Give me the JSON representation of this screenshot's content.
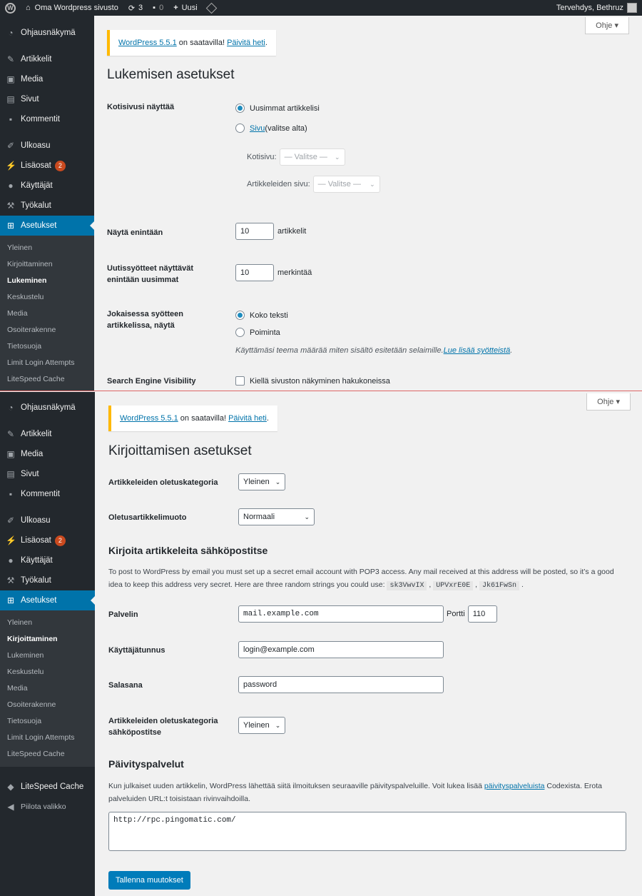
{
  "adminbar": {
    "site_name": "Oma Wordpress sivusto",
    "updates": "3",
    "comments": "0",
    "new_label": "Uusi",
    "greeting": "Tervehdys, Bethruz"
  },
  "panel1": {
    "menu": [
      {
        "label": "Ohjausnäkymä",
        "icon": "dashboard-icon"
      },
      {
        "label": "Artikkelit",
        "icon": "pin-icon"
      },
      {
        "label": "Media",
        "icon": "media-icon"
      },
      {
        "label": "Sivut",
        "icon": "page-icon"
      },
      {
        "label": "Kommentit",
        "icon": "comment-icon"
      },
      {
        "label": "Ulkoasu",
        "icon": "brush-icon"
      },
      {
        "label": "Lisäosat",
        "icon": "plugin-icon",
        "badge": "2"
      },
      {
        "label": "Käyttäjät",
        "icon": "user-icon"
      },
      {
        "label": "Työkalut",
        "icon": "wrench-icon"
      },
      {
        "label": "Asetukset",
        "icon": "settings-icon"
      }
    ],
    "submenu": [
      "Yleinen",
      "Kirjoittaminen",
      "Lukeminen",
      "Keskustelu",
      "Media",
      "Osoiterakenne",
      "Tietosuoja",
      "Limit Login Attempts",
      "LiteSpeed Cache"
    ],
    "help": "Ohje ▾",
    "notice": {
      "link1": "WordPress 5.5.1",
      "middle": " on saatavilla! ",
      "link2": "Päivitä heti",
      "end": "."
    },
    "title": "Lukemisen asetukset",
    "homepage_label": "Kotisivusi näyttää",
    "opt_latest": "Uusimmat artikkelisi",
    "opt_page_link": "Sivu",
    "opt_page_rest": " (valitse alta)",
    "homepage_sub": "Kotisivu:",
    "posts_page_sub": "Artikkeleiden sivu:",
    "select_placeholder": "— Valitse —",
    "show_max_label": "Näytä enintään",
    "show_max_value": "10",
    "show_max_unit": "artikkelit",
    "feed_label_1": "Uutissyötteet näyttävät",
    "feed_label_2": "enintään uusimmat",
    "feed_value": "10",
    "feed_unit": "merkintää",
    "each_label_1": "Jokaisessa syötteen",
    "each_label_2": "artikkelissa, näytä",
    "opt_full": "Koko teksti",
    "opt_summary": "Poiminta",
    "theme_desc": "Käyttämäsi teema määrää miten sisältö esitetään selaimille. ",
    "theme_link": "Lue lisää syötteistä",
    "theme_end": ".",
    "sev_label": "Search Engine Visibility",
    "sev_check": "Kiellä sivuston näkyminen hakukoneissa"
  },
  "panel2": {
    "menu": [
      {
        "label": "Ohjausnäkymä",
        "icon": "dashboard-icon"
      },
      {
        "label": "Artikkelit",
        "icon": "pin-icon"
      },
      {
        "label": "Media",
        "icon": "media-icon"
      },
      {
        "label": "Sivut",
        "icon": "page-icon"
      },
      {
        "label": "Kommentit",
        "icon": "comment-icon"
      },
      {
        "label": "Ulkoasu",
        "icon": "brush-icon"
      },
      {
        "label": "Lisäosat",
        "icon": "plugin-icon",
        "badge": "2"
      },
      {
        "label": "Käyttäjät",
        "icon": "user-icon"
      },
      {
        "label": "Työkalut",
        "icon": "wrench-icon"
      },
      {
        "label": "Asetukset",
        "icon": "settings-icon"
      }
    ],
    "submenu": [
      "Yleinen",
      "Kirjoittaminen",
      "Lukeminen",
      "Keskustelu",
      "Media",
      "Osoiterakenne",
      "Tietosuoja",
      "Limit Login Attempts",
      "LiteSpeed Cache"
    ],
    "extra_menu": [
      {
        "label": "LiteSpeed Cache",
        "icon": "litespeed-icon"
      },
      {
        "label": "Piilota valikko",
        "icon": "collapse-icon"
      }
    ],
    "help": "Ohje ▾",
    "notice": {
      "link1": "WordPress 5.5.1",
      "middle": " on saatavilla! ",
      "link2": "Päivitä heti",
      "end": "."
    },
    "title": "Kirjoittamisen asetukset",
    "default_cat_label": "Artikkeleiden oletuskategoria",
    "default_cat_value": "Yleinen",
    "default_format_label": "Oletusartikkelimuoto",
    "default_format_value": "Normaali",
    "post_via_email_heading": "Kirjoita artikkeleita sähköpostitse",
    "email_desc_1": "To post to WordPress by email you must set up a secret email account with POP3 access. Any mail received at this address will be posted, so it’s a good",
    "email_desc_2": "idea to keep this address very secret. Here are three random strings you could use:",
    "codes": [
      "sk3VwvIX",
      "UPVxrE0E",
      "Jk61FwSn"
    ],
    "server_label": "Palvelin",
    "server_value": "mail.example.com",
    "port_label": "Portti",
    "port_value": "110",
    "username_label": "Käyttäjätunnus",
    "username_value": "login@example.com",
    "password_label": "Salasana",
    "password_value": "password",
    "email_cat_label_1": "Artikkeleiden oletuskategoria",
    "email_cat_label_2": "sähköpostitse",
    "email_cat_value": "Yleinen",
    "update_heading": "Päivityspalvelut",
    "update_desc_1": "Kun julkaiset uuden artikkelin, WordPress lähettää siitä ilmoituksen seuraaville päivityspalveluille. Voit lukea lisää ",
    "update_desc_link": "päivityspalveluista",
    "update_desc_2": " Codexista. Erota",
    "update_desc_3": "palveluiden URL:t toisistaan rivinvaihdoilla.",
    "ping_value": "http://rpc.pingomatic.com/",
    "save_label": "Tallenna muutokset"
  }
}
